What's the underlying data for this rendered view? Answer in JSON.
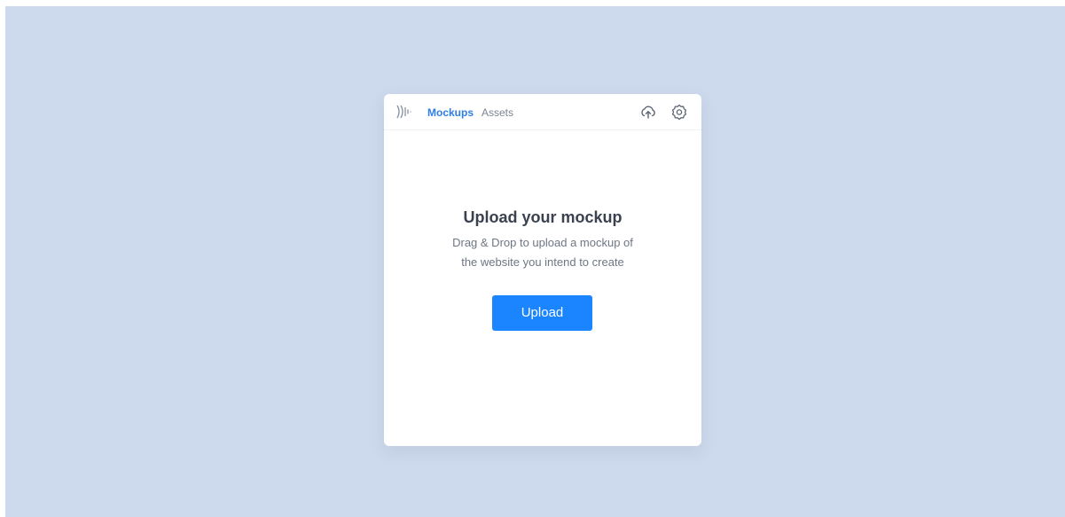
{
  "header": {
    "logo_icon": "sound-wave-logo-icon",
    "tabs": [
      {
        "label": "Mockups",
        "active": true
      },
      {
        "label": "Assets",
        "active": false
      }
    ],
    "actions": [
      {
        "icon": "cloud-upload-icon"
      },
      {
        "icon": "gear-icon"
      }
    ]
  },
  "main": {
    "title": "Upload your mockup",
    "description_line_1": "Drag & Drop to upload a mockup of",
    "description_line_2": "the website you intend to create",
    "upload_button_label": "Upload"
  },
  "colors": {
    "background": "#cdd9ec",
    "accent": "#1a85ff",
    "active_tab": "#2d7ee8"
  }
}
